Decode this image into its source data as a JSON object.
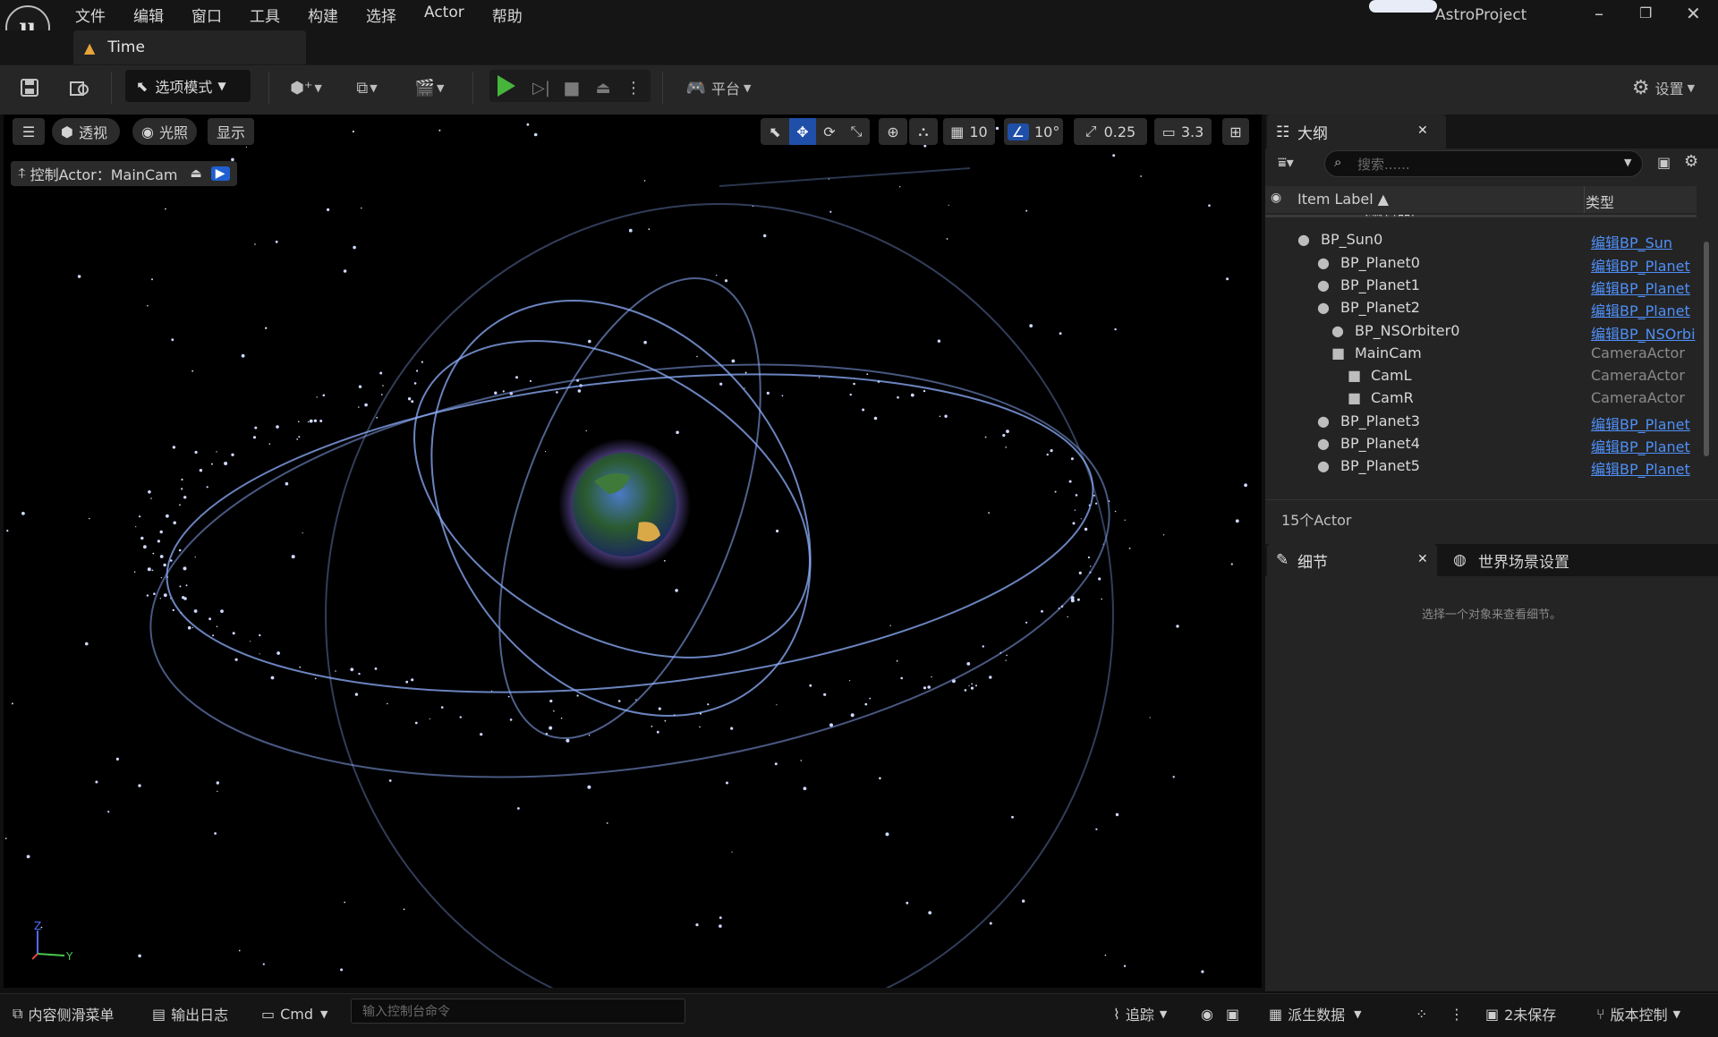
{
  "menubar": {
    "logo": "u",
    "items": [
      "文件",
      "编辑",
      "窗口",
      "工具",
      "构建",
      "选择",
      "Actor",
      "帮助"
    ],
    "app_title": "AstroProject"
  },
  "doc_tab": {
    "label": "Time",
    "icon": "level-icon"
  },
  "toolbar": {
    "mode_label": "选项模式",
    "platform_label": "平台",
    "settings_label": "设置"
  },
  "viewport": {
    "menu_icon": "hamburger-icon",
    "perspective": "透视",
    "lighting": "光照",
    "show": "显示",
    "grid_value": "10",
    "rotation_snap": "10°",
    "scale_snap": "0.25",
    "camera_speed": "3.3",
    "pilot_label": "控制Actor：MainCam",
    "axis_z": "Z",
    "axis_y": "Y"
  },
  "outliner": {
    "tab_label": "大纲",
    "search_placeholder": "搜索......",
    "col_label": "Item Label ▲",
    "col_type": "类型",
    "rows": [
      {
        "label": "Time（编辑器）",
        "type": "",
        "indent": 0,
        "kind": "plain"
      },
      {
        "label": "BP_Sun0",
        "type": "编辑BP_Sun",
        "indent": 1,
        "kind": "link"
      },
      {
        "label": "BP_Planet0",
        "type": "编辑BP_Planet",
        "indent": 2,
        "kind": "link"
      },
      {
        "label": "BP_Planet1",
        "type": "编辑BP_Planet",
        "indent": 2,
        "kind": "link"
      },
      {
        "label": "BP_Planet2",
        "type": "编辑BP_Planet",
        "indent": 2,
        "kind": "link"
      },
      {
        "label": "BP_NSOrbiter0",
        "type": "编辑BP_NSOrbi",
        "indent": 3,
        "kind": "link"
      },
      {
        "label": "MainCam",
        "type": "CameraActor",
        "indent": 3,
        "kind": "plain"
      },
      {
        "label": "CamL",
        "type": "CameraActor",
        "indent": 4,
        "kind": "plain"
      },
      {
        "label": "CamR",
        "type": "CameraActor",
        "indent": 4,
        "kind": "plain"
      },
      {
        "label": "BP_Planet3",
        "type": "编辑BP_Planet",
        "indent": 2,
        "kind": "link"
      },
      {
        "label": "BP_Planet4",
        "type": "编辑BP_Planet",
        "indent": 2,
        "kind": "link"
      },
      {
        "label": "BP_Planet5",
        "type": "编辑BP_Planet",
        "indent": 2,
        "kind": "link"
      }
    ],
    "count": "15个Actor"
  },
  "details": {
    "tab_label": "细节",
    "world_tab_label": "世界场景设置",
    "empty_text": "选择一个对象来查看细节。"
  },
  "statusbar": {
    "content_drawer": "内容侧滑菜单",
    "output_log": "输出日志",
    "cmd": "Cmd",
    "cmd_placeholder": "输入控制台命令",
    "trace": "追踪",
    "derived_data": "派生数据",
    "unsaved": "2未保存",
    "source_control": "版本控制"
  }
}
